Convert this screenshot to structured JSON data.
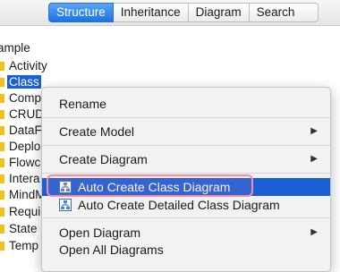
{
  "tabs": [
    {
      "label": "Structure",
      "active": true
    },
    {
      "label": "Inheritance",
      "active": false
    },
    {
      "label": "Diagram",
      "active": false
    },
    {
      "label": "Search",
      "active": false
    }
  ],
  "tree": {
    "root": "ample",
    "items": [
      {
        "label": "Activity"
      },
      {
        "label": "Class",
        "selected": true
      },
      {
        "label": "Comp"
      },
      {
        "label": "CRUD"
      },
      {
        "label": "DataF"
      },
      {
        "label": "Deplo"
      },
      {
        "label": "Flowc"
      },
      {
        "label": "Intera"
      },
      {
        "label": "MindM"
      },
      {
        "label": "Requi"
      },
      {
        "label": "State"
      },
      {
        "label": "Temp"
      }
    ]
  },
  "menu": {
    "rename": "Rename",
    "create_model": "Create Model",
    "create_diagram": "Create Diagram",
    "auto_create_class_diagram": "Auto Create Class Diagram",
    "auto_create_detailed_class_diagram": "Auto Create Detailed Class Diagram",
    "open_diagram": "Open Diagram",
    "open_all_diagrams": "Open All Diagrams",
    "submenu_arrow": "▶"
  },
  "colors": {
    "selection": "#1a5fd6",
    "folder": "#f2c118",
    "highlight_ring": "#f08ea5"
  }
}
